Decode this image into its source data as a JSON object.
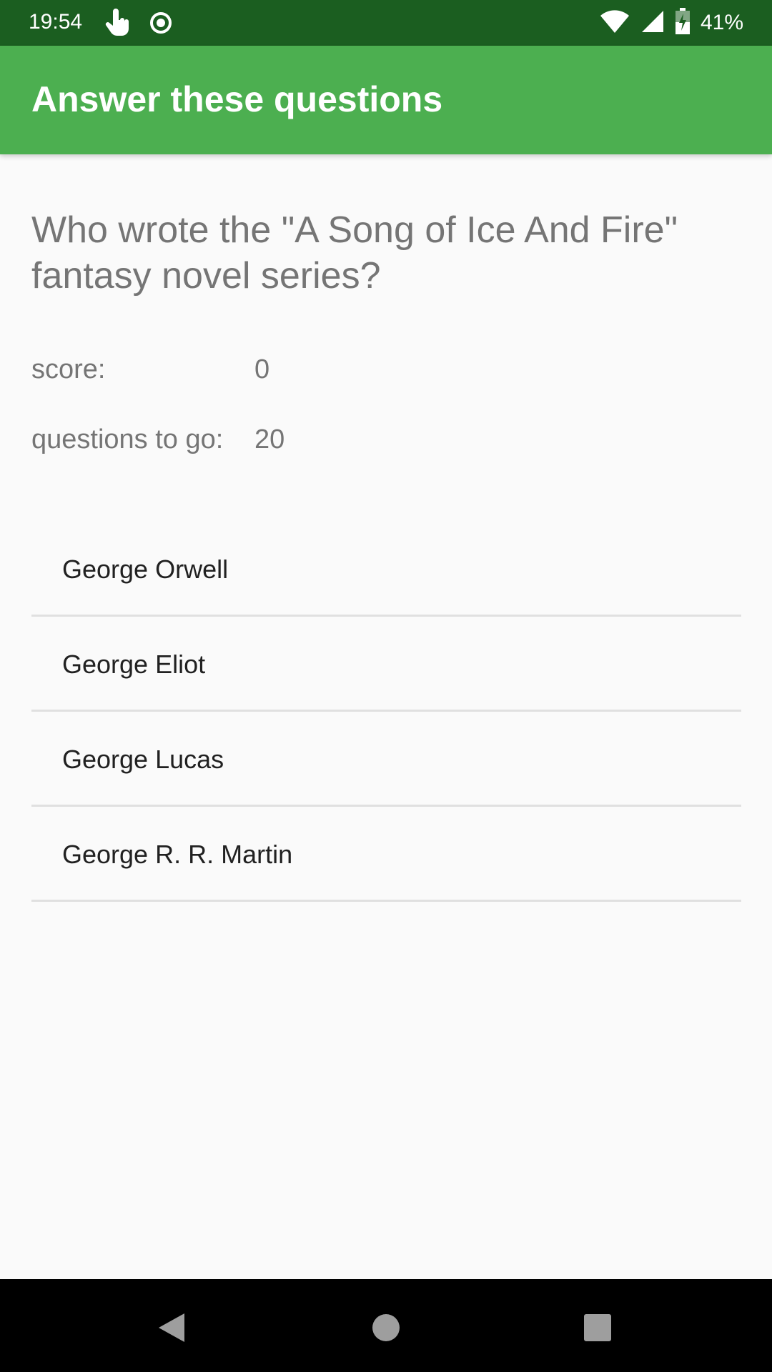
{
  "status_bar": {
    "time": "19:54",
    "battery_percent": "41%",
    "icons": [
      "touch-gesture-icon",
      "record-icon",
      "wifi-icon",
      "cell-signal-icon",
      "battery-charging-icon"
    ],
    "background_color": "#1b5e20"
  },
  "app_bar": {
    "title": "Answer these questions",
    "background_color": "#4caf50"
  },
  "quiz": {
    "question": "Who wrote the \"A Song of Ice And Fire\" fantasy novel series?",
    "score_label": "score:",
    "score_value": "0",
    "questions_to_go_label": "questions to go:",
    "questions_to_go_value": "20",
    "answers": [
      {
        "label": "George Orwell"
      },
      {
        "label": "George Eliot"
      },
      {
        "label": "George Lucas"
      },
      {
        "label": "George R. R. Martin"
      }
    ]
  },
  "nav_bar": {
    "buttons": [
      "back-icon",
      "home-icon",
      "recents-icon"
    ]
  }
}
